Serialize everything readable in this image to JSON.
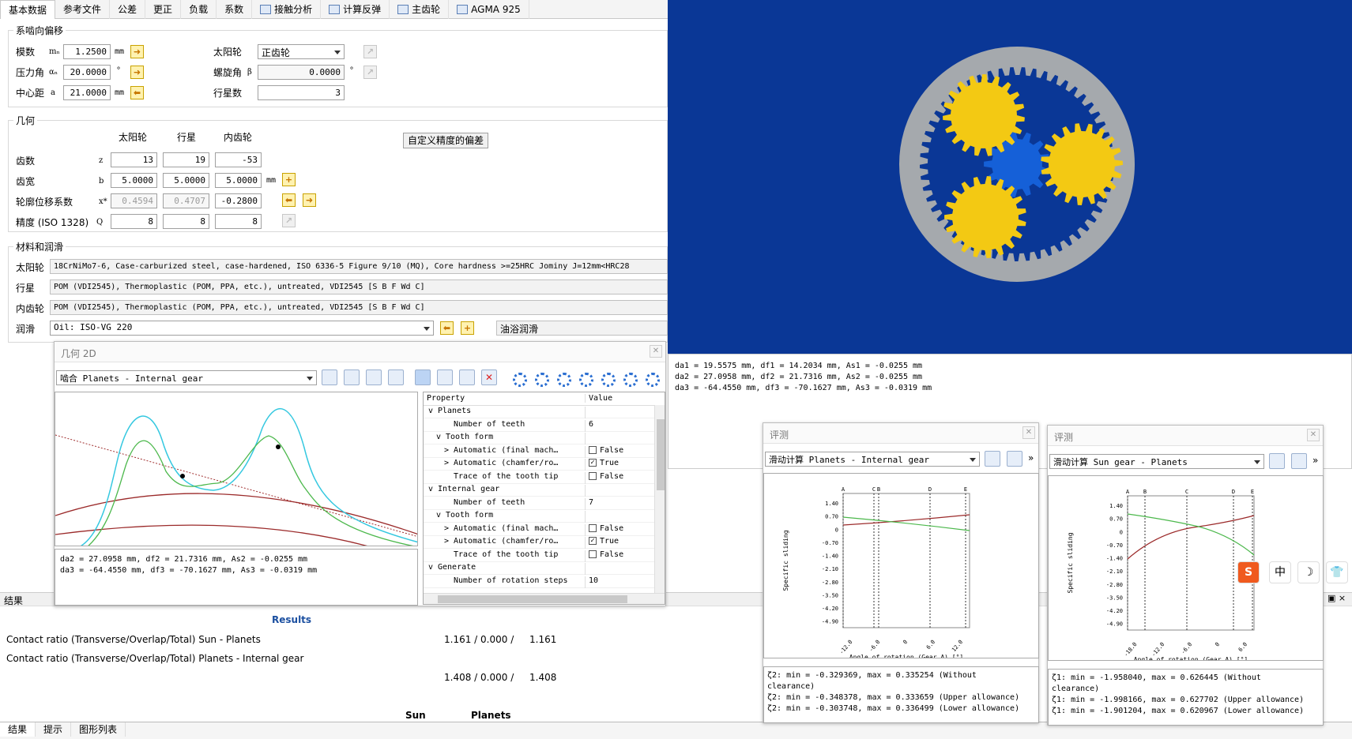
{
  "tabs": [
    "基本数据",
    "参考文件",
    "公差",
    "更正",
    "负载",
    "系数",
    "接触分析",
    "计算反弹",
    "主齿轮",
    "AGMA 925"
  ],
  "basic": {
    "legend": "系啮向偏移",
    "module_label": "模数",
    "module_sym": "mₙ",
    "module_val": "1.2500",
    "module_unit": "mm",
    "pressure_label": "压力角",
    "pressure_sym": "αₙ",
    "pressure_val": "20.0000",
    "pressure_unit": "°",
    "center_label": "中心距",
    "center_sym": "a",
    "center_val": "21.0000",
    "center_unit": "mm",
    "sun_label": "太阳轮",
    "sun_type": "正齿轮",
    "helix_label": "螺旋角",
    "helix_sym": "β",
    "helix_val": "0.0000",
    "helix_unit": "°",
    "planets_label": "行星数",
    "planets_val": "3"
  },
  "geometry": {
    "legend": "几何",
    "col_sun": "太阳轮",
    "col_planet": "行星",
    "col_ring": "内齿轮",
    "custom_btn": "自定义精度的偏差",
    "teeth_label": "齿数",
    "teeth_sym": "z",
    "teeth": [
      "13",
      "19",
      "-53"
    ],
    "width_label": "齿宽",
    "width_sym": "b",
    "width": [
      "5.0000",
      "5.0000",
      "5.0000"
    ],
    "width_unit": "mm",
    "shift_label": "轮廓位移系数",
    "shift_sym": "x*",
    "shift": [
      "0.4594",
      "0.4707",
      "-0.2800"
    ],
    "quality_label": "精度 (ISO 1328)",
    "quality_sym": "Q",
    "quality": [
      "8",
      "8",
      "8"
    ]
  },
  "materials": {
    "legend": "材料和润滑",
    "sun_label": "太阳轮",
    "sun_mat": "18CrNiMo7-6, Case-carburized steel, case-hardened, ISO 6336-5 Figure 9/10 (MQ), Core hardness >=25HRC Jominy J=12mm<HRC28",
    "planet_label": "行星",
    "planet_mat": "POM (VDI2545), Thermoplastic (POM, PPA, etc.), untreated, VDI2545 [S B F Wd C]",
    "ring_label": "内齿轮",
    "ring_mat": "POM (VDI2545), Thermoplastic (POM, PPA, etc.), untreated, VDI2545 [S B F Wd C]",
    "lube_label": "润滑",
    "lube": "Oil: ISO-VG 220",
    "lube_type": "油浴润滑"
  },
  "gear_view": {
    "text": [
      "da1 = 19.5575 mm,  df1 = 14.2034 mm,  As1 = -0.0255 mm",
      "da2 = 27.0958 mm,  df2 = 21.7316 mm,  As2 = -0.0255 mm",
      "da3 = -64.4550 mm,  df3 = -70.1627 mm,  As3 = -0.0319 mm"
    ],
    "colors": {
      "bg": "#0a3796",
      "sun": "#1560d8",
      "planet": "#f3c913",
      "ring": "#a5a9ad"
    }
  },
  "geom2d": {
    "title": "几何 2D",
    "combo": "啮合 Planets - Internal gear",
    "text": [
      "da2 = 27.0958 mm,  df2 = 21.7316 mm,  As2 = -0.0255 mm",
      "da3 = -64.4550 mm,  df3 = -70.1627 mm,  As3 = -0.0319 mm"
    ],
    "prop_header": "Property",
    "value_header": "Value",
    "rows": [
      {
        "l": "Planets",
        "v": "",
        "ind": 1,
        "exp": "v"
      },
      {
        "l": "Number of teeth",
        "v": "6",
        "ind": 3,
        "exp": ""
      },
      {
        "l": "Tooth form",
        "v": "",
        "ind": 2,
        "exp": "v"
      },
      {
        "l": "Automatic (final mach…",
        "v": "False",
        "ind": 3,
        "exp": ">",
        "chk": ""
      },
      {
        "l": "Automatic (chamfer/ro…",
        "v": "True",
        "ind": 3,
        "exp": ">",
        "chk": "✓"
      },
      {
        "l": "Trace of the tooth tip",
        "v": "False",
        "ind": 3,
        "exp": "",
        "chk": ""
      },
      {
        "l": "Internal gear",
        "v": "",
        "ind": 1,
        "exp": "v"
      },
      {
        "l": "Number of teeth",
        "v": "7",
        "ind": 3,
        "exp": ""
      },
      {
        "l": "Tooth form",
        "v": "",
        "ind": 2,
        "exp": "v"
      },
      {
        "l": "Automatic (final mach…",
        "v": "False",
        "ind": 3,
        "exp": ">",
        "chk": ""
      },
      {
        "l": "Automatic (chamfer/ro…",
        "v": "True",
        "ind": 3,
        "exp": ">",
        "chk": "✓"
      },
      {
        "l": "Trace of the tooth tip",
        "v": "False",
        "ind": 3,
        "exp": "",
        "chk": ""
      },
      {
        "l": "Generate",
        "v": "",
        "ind": 1,
        "exp": "v"
      },
      {
        "l": "Number of rotation steps",
        "v": "10",
        "ind": 3,
        "exp": ""
      }
    ]
  },
  "eval1": {
    "title": "评测",
    "combo": "滑动计算 Planets - Internal gear",
    "ylabel": "Specific sliding",
    "xlabel": "Angle of rotation (Gear A) [°]",
    "markers": [
      "A",
      "C",
      "B",
      "D",
      "E"
    ],
    "yticks": [
      "1.40",
      "0.70",
      "0",
      "-0.70",
      "-1.40",
      "-2.10",
      "-2.80",
      "-3.50",
      "-4.20",
      "-4.90"
    ],
    "xticks": [
      "-12.0",
      "-6.0",
      "0",
      "6.0",
      "12.0"
    ],
    "text": [
      "ζ2: min = -0.329369, max = 0.335254 (Without clearance)",
      "ζ2: min = -0.348378, max = 0.333659 (Upper allowance)",
      "ζ2: min = -0.303748, max = 0.336499 (Lower allowance)"
    ]
  },
  "eval2": {
    "title": "评测",
    "combo": "滑动计算 Sun gear - Planets",
    "ylabel": "Specific sliding",
    "xlabel": "Angle of rotation (Gear A) [°]",
    "markers": [
      "A",
      "B",
      "C",
      "D",
      "E"
    ],
    "yticks": [
      "1.40",
      "0.70",
      "0",
      "-0.70",
      "-1.40",
      "-2.10",
      "-2.80",
      "-3.50",
      "-4.20",
      "-4.90"
    ],
    "xticks": [
      "-18.0",
      "-12.0",
      "-6.0",
      "0",
      "6.0"
    ],
    "text": [
      "ζ1: min = -1.958040, max = 0.626445 (Without clearance)",
      "ζ1: min = -1.998166, max = 0.627702 (Upper allowance)",
      "ζ1: min = -1.901204, max = 0.620967 (Lower allowance)"
    ]
  },
  "results": {
    "header": "结果",
    "title": "Results",
    "r1_label": "Contact ratio (Transverse/Overlap/Total) Sun - Planets",
    "r1_val": "1.161 / 0.000 /",
    "r1_total": "1.161",
    "r2_label": "Contact ratio (Transverse/Overlap/Total) Planets - Internal gear",
    "r2_val": "1.408 / 0.000 /",
    "r2_total": "1.408",
    "col_sun": "Sun",
    "col_planets": "Planets",
    "bottom_tabs": [
      "结果",
      "提示",
      "图形列表"
    ]
  },
  "ime": [
    "S",
    "中",
    "☽",
    "👕"
  ]
}
